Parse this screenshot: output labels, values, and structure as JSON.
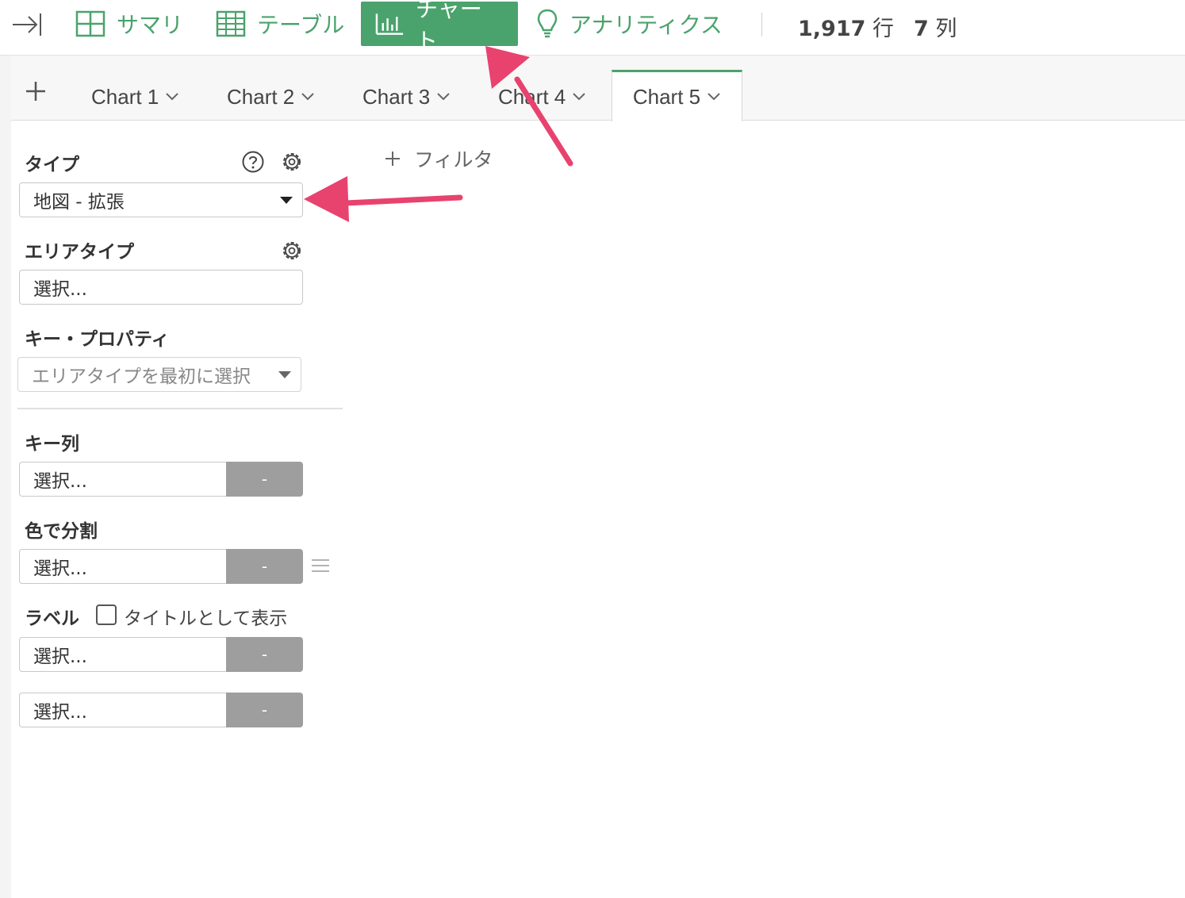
{
  "toolbar": {
    "nav": [
      {
        "label": "サマリ",
        "icon": "summary-grid-icon"
      },
      {
        "label": "テーブル",
        "icon": "table-icon"
      },
      {
        "label": "チャート",
        "icon": "bar-chart-icon",
        "active": true
      },
      {
        "label": "アナリティクス",
        "icon": "lightbulb-icon"
      }
    ],
    "row_count": "1,917",
    "row_unit": "行",
    "col_count": "7",
    "col_unit": "列"
  },
  "tabs": [
    {
      "label": "Chart 1"
    },
    {
      "label": "Chart 2"
    },
    {
      "label": "Chart 3"
    },
    {
      "label": "Chart 4"
    },
    {
      "label": "Chart 5",
      "active": true
    }
  ],
  "panel": {
    "type_label": "タイプ",
    "type_value": "地図 - 拡張",
    "area_type_label": "エリアタイプ",
    "area_type_placeholder": "選択...",
    "key_property_label": "キー・プロパティ",
    "key_property_placeholder": "エリアタイプを最初に選択",
    "key_column_label": "キー列",
    "key_column_value": "選択...",
    "color_split_label": "色で分割",
    "color_split_value": "選択...",
    "label_label": "ラベル",
    "show_as_title_label": "タイトルとして表示",
    "label_value_1": "選択...",
    "label_value_2": "選択...",
    "remove_button_label": "-"
  },
  "filter": {
    "label": "フィルタ"
  },
  "colors": {
    "accent": "#4aa36c",
    "annotation": "#e8426e",
    "button_gray": "#9e9e9e"
  }
}
